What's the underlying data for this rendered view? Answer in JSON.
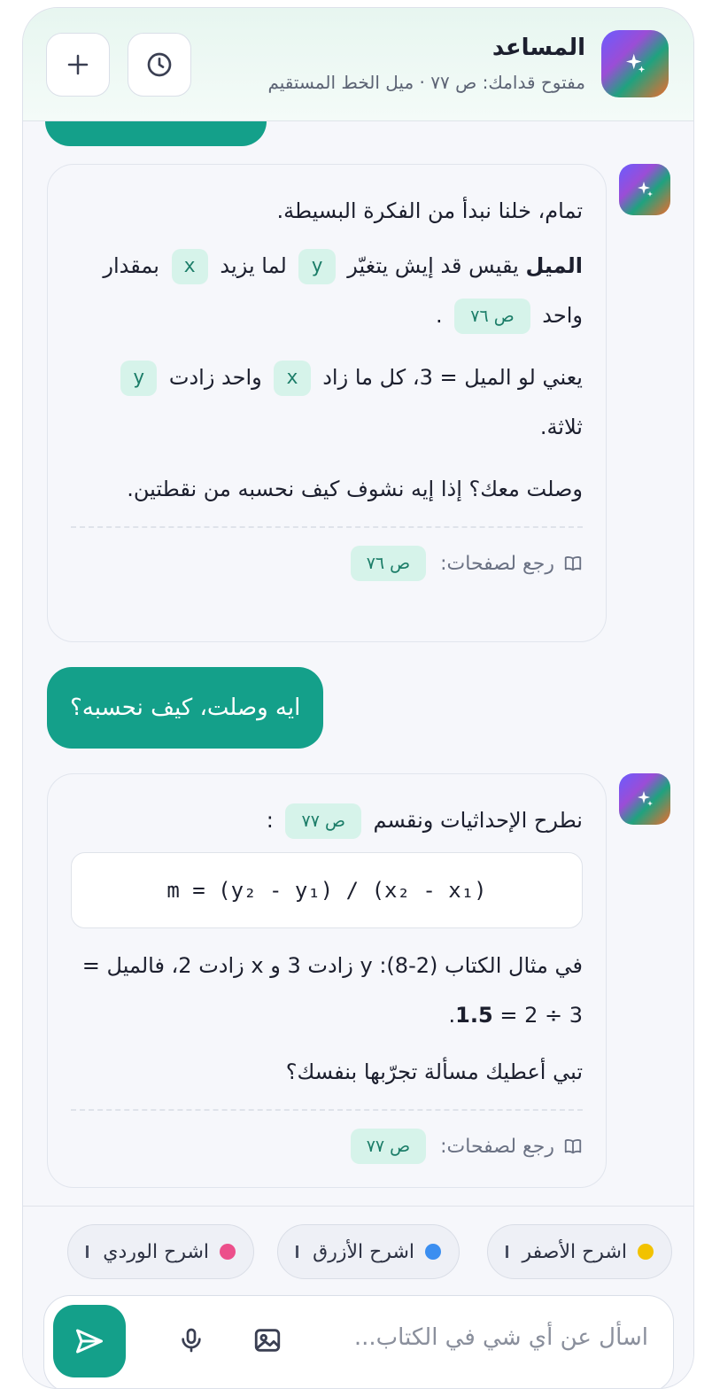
{
  "header": {
    "title": "المساعد",
    "subtitle": "مفتوح قدامك: ص ٧٧ · ميل الخط المستقيم",
    "new_chat_icon": "plus-icon",
    "history_icon": "clock-icon",
    "logo_icon": "sparkle-icon"
  },
  "messages": {
    "bot1": {
      "line1": "تمام، خلنا نبدأ من الفكرة البسيطة.",
      "p2_bold": "الميل",
      "p2_a": " يقيس قد إيش يتغيّر ",
      "p2_var_y": "y",
      "p2_b": " لما يزيد ",
      "p2_var_x": "x",
      "p2_c": " بمقدار واحد ",
      "p2_page": "ص ٧٦",
      "p2_end": " .",
      "p3_a": "يعني لو الميل = 3، كل ما زاد ",
      "p3_var_x": "x",
      "p3_b": " واحد زادت ",
      "p3_var_y": "y",
      "p3_c": " ثلاثة.",
      "p4": "وصلت معك؟ إذا إيه نشوف كيف نحسبه من نقطتين.",
      "refs_label": "رجع لصفحات:",
      "refs_page": "ص ٧٦"
    },
    "user1": "ايه وصلت، كيف نحسبه؟",
    "bot2": {
      "p1_a": "نطرح الإحداثيات ونقسم ",
      "p1_page": "ص ٧٧",
      "p1_end": " :",
      "formula": "m = (y₂ - y₁) / (x₂ - x₁)",
      "p2_a": "في مثال الكتاب (2-8): y زادت 3 و x زادت 2، فالميل = 3 ÷ 2 = ",
      "p2_bold": "1.5",
      "p2_end": ".",
      "p3": "تبي أعطيك مسألة تجرّبها بنفسك؟",
      "refs_label": "رجع لصفحات:",
      "refs_page": "ص ٧٧"
    }
  },
  "suggestions": [
    {
      "label": "اشرح الأصفر",
      "color": "#f2c200"
    },
    {
      "label": "اشرح الأزرق",
      "color": "#3b8ef0"
    },
    {
      "label": "اشرح الوردي",
      "color": "#ec4f8b"
    }
  ],
  "composer": {
    "placeholder": "اسأل عن أي شي في الكتاب...",
    "image_icon": "image-icon",
    "mic_icon": "microphone-icon",
    "send_icon": "send-icon"
  },
  "colors": {
    "accent": "#14a08a",
    "chip_bg": "#d6f3ea",
    "chip_text": "#1b7d68"
  }
}
